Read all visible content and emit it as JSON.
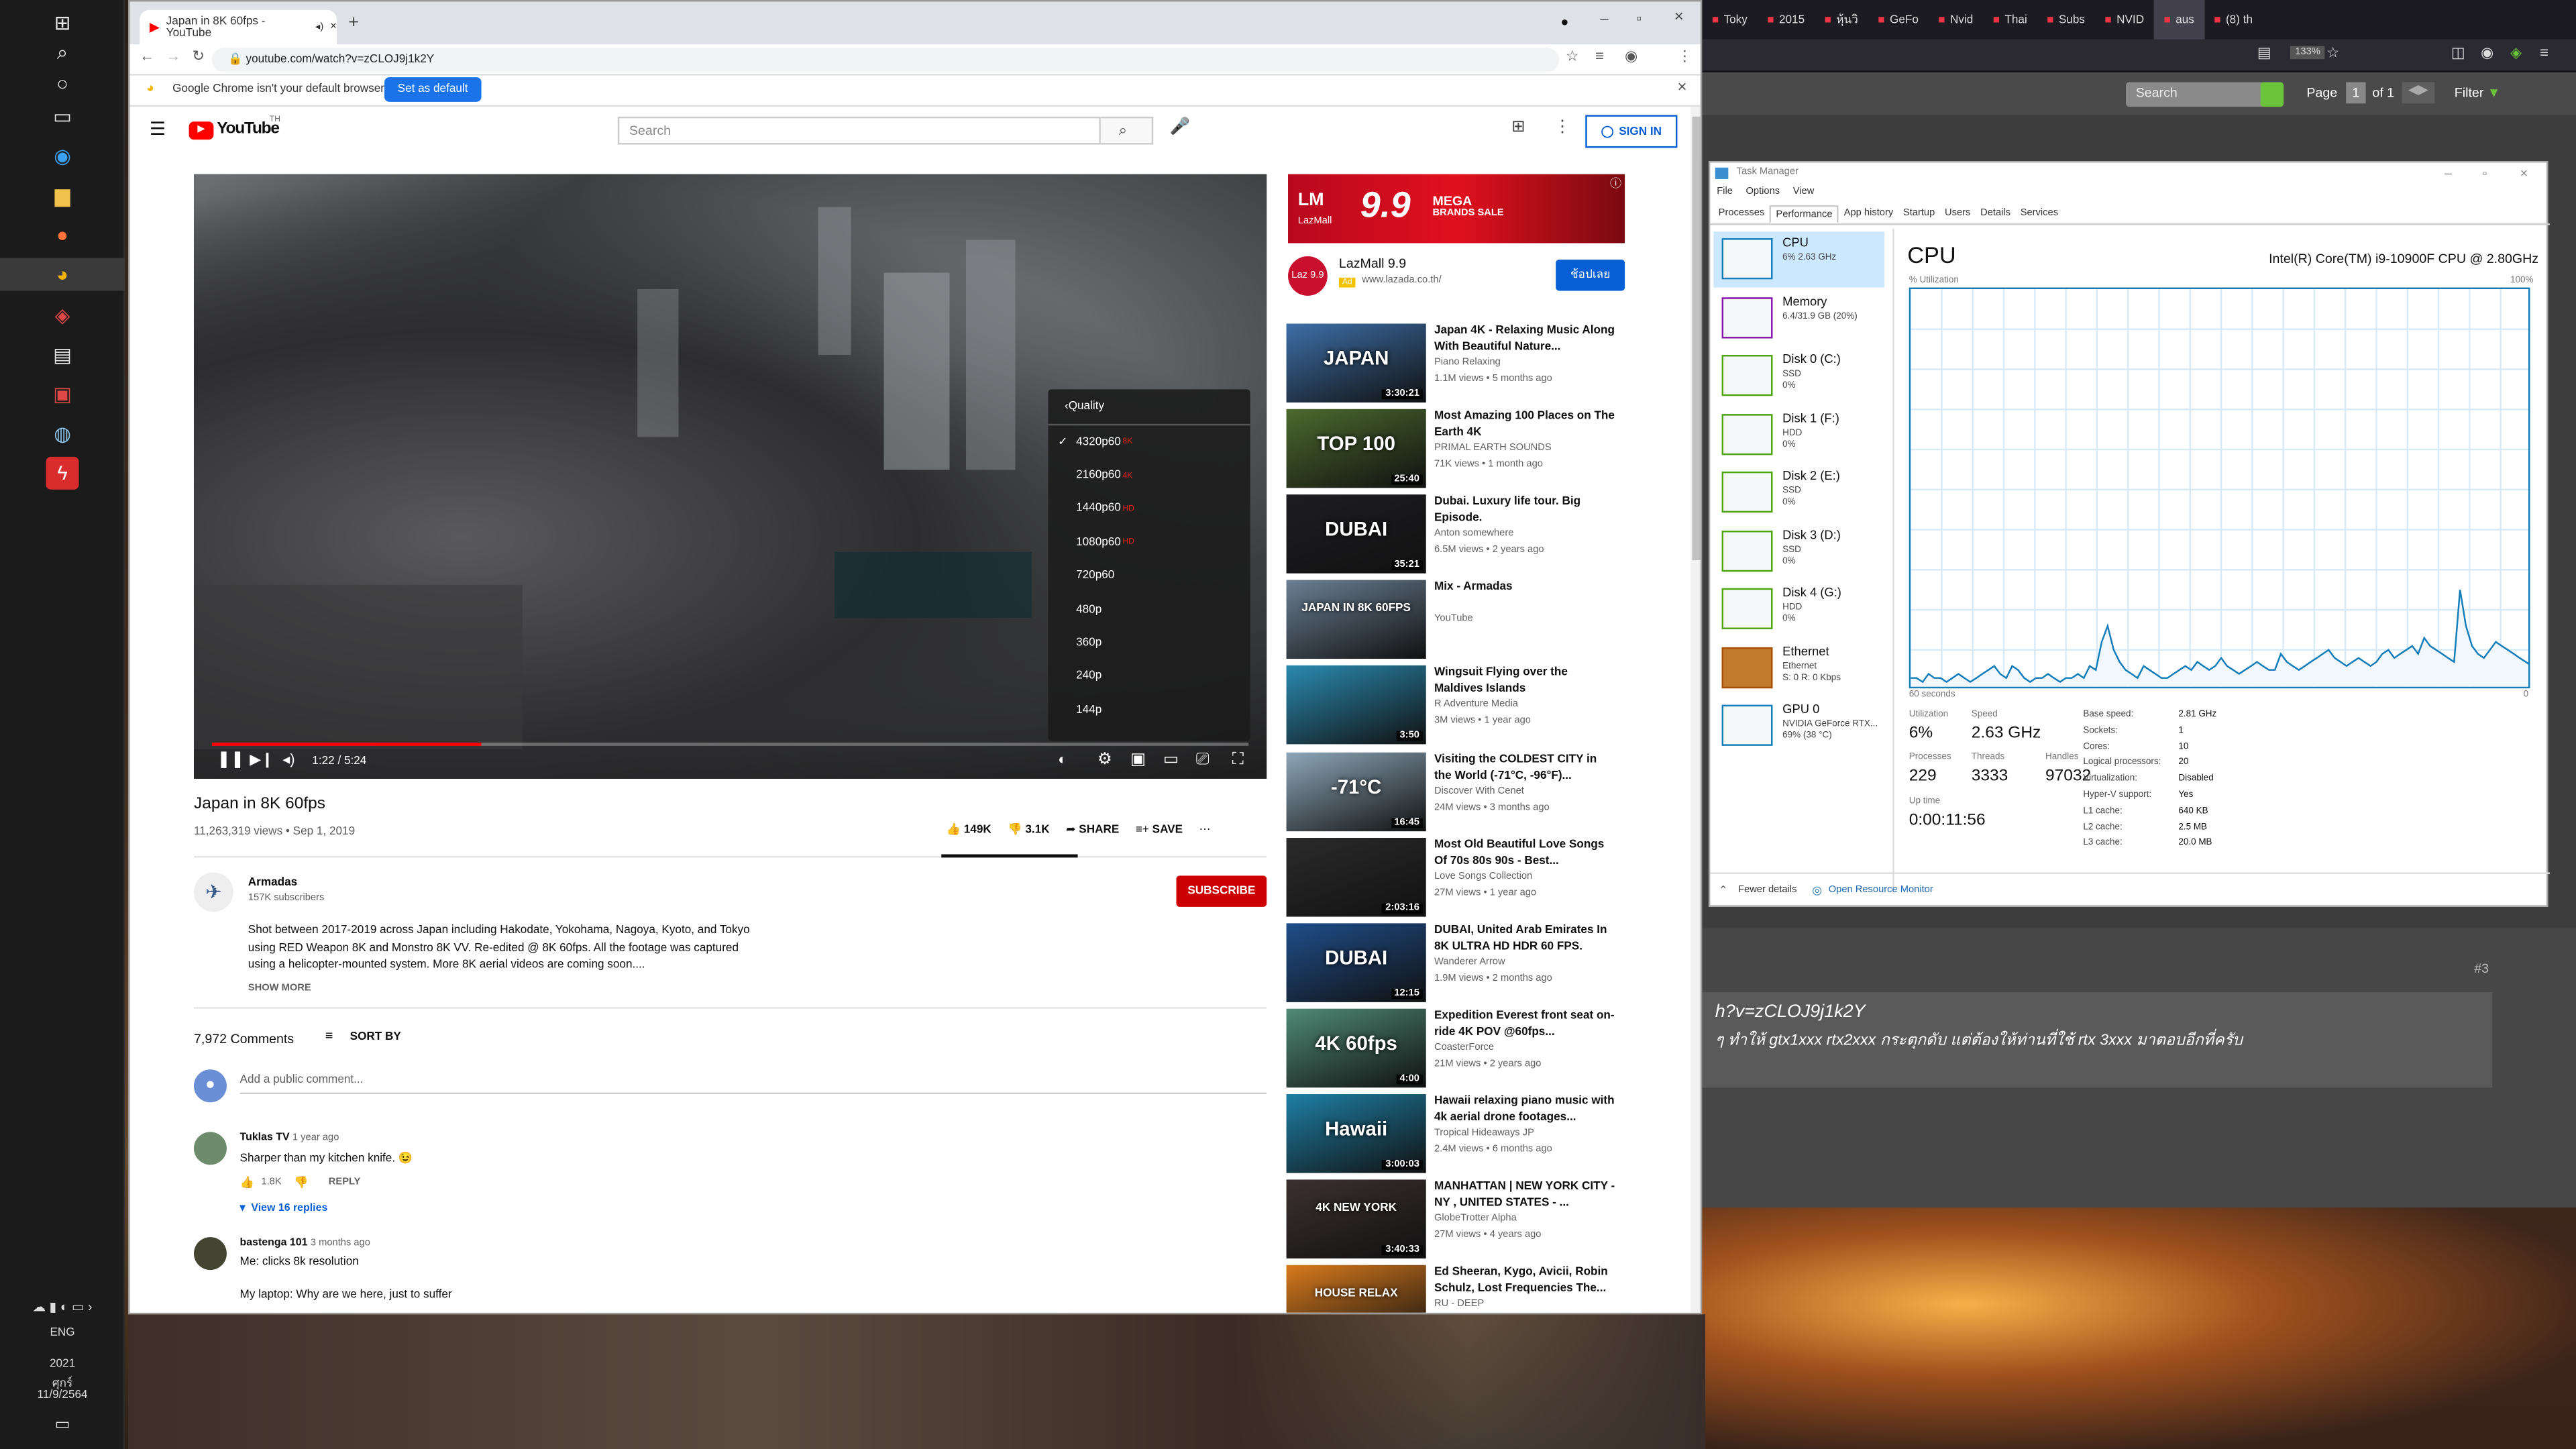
{
  "taskbar": {
    "lang": "ENG",
    "time": "2021",
    "day": "ศุกร์",
    "date": "11/9/2564"
  },
  "firefox": {
    "tabs": [
      "Toky",
      "2015",
      "หุ้นวิ",
      "GeFo",
      "Nvid",
      "Thai",
      "Subs",
      "NVID",
      "aus",
      "(8) th"
    ],
    "zoom": "133%",
    "search_placeholder": "Search",
    "page_label": "Page",
    "page_num": "1",
    "page_of": "of 1",
    "filter": "Filter",
    "post_num": "#3",
    "quote_line1": "h?v=zCLOJ9j1k2Y",
    "quote_line2": "ๆ ทำให้ gtx1xxx rtx2xxx กระตุกดับ แต่ต้องให้ท่านที่ใช้ rtx 3xxx มาตอบอีกที่ครับ"
  },
  "chrome": {
    "tab_title": "Japan in 8K 60fps - YouTube",
    "url": "youtube.com/watch?v=zCLOJ9j1k2Y",
    "default_msg": "Google Chrome isn't your default browser",
    "set_default": "Set as default"
  },
  "youtube": {
    "logo": "YouTube",
    "logo_sup": "TH",
    "search_placeholder": "Search",
    "sign_in": "SIGN IN",
    "quality_menu": {
      "header": "Quality",
      "options": [
        "4320p60",
        "2160p60",
        "1440p60",
        "1080p60",
        "720p60",
        "480p",
        "360p",
        "240p",
        "144p"
      ],
      "hd": [
        "8K",
        "4K",
        "HD",
        "HD",
        "",
        "",
        "",
        "",
        ""
      ],
      "selected": "4320p60"
    },
    "time": "1:22 / 5:24",
    "progress": 0.26,
    "title": "Japan in 8K 60fps",
    "meta": "11,263,319 views • Sep 1, 2019",
    "likes": "149K",
    "dislikes": "3.1K",
    "share": "SHARE",
    "save": "SAVE",
    "channel": "Armadas",
    "subscribers": "157K subscribers",
    "subscribe": "SUBSCRIBE",
    "description": "Shot between 2017-2019 across Japan including Hakodate, Yokohama, Nagoya, Kyoto, and Tokyo  using RED Weapon 8K and Monstro 8K VV. Re-edited @ 8K 60fps. All the footage was captured using a helicopter-mounted system. More 8K aerial videos are coming soon....",
    "show_more": "SHOW MORE",
    "comments_count": "7,972 Comments",
    "sort_by": "SORT BY",
    "add_comment": "Add a public comment...",
    "comments": [
      {
        "author": "Tuklas TV",
        "age": "1 year ago",
        "text": "Sharper than my kitchen knife. 😉",
        "likes": "1.8K",
        "reply": "REPLY",
        "view_replies": "View 16 replies"
      },
      {
        "author": "bastenga 101",
        "age": "3 months ago",
        "text": "Me: clicks 8k resolution",
        "text2": "My laptop: Why are we here, just to suffer"
      }
    ],
    "ad": {
      "brand": "LazMall",
      "big": "9.9",
      "sub1": "MEGA",
      "sub2": "BRANDS SALE",
      "name": "LazMall 9.9",
      "ad_tag": "Ad",
      "site": "www.lazada.co.th/",
      "cta": "ช้อปเลย",
      "logo": "Laz 9.9"
    },
    "recs": [
      {
        "title": "Japan 4K - Relaxing Music Along With Beautiful Nature...",
        "channel": "Piano Relaxing",
        "views": "1.1M views • 5 months ago",
        "dur": "3:30:21",
        "thumb": "JAPAN",
        "color": "#3d6fa8"
      },
      {
        "title": "Most Amazing 100 Places on The Earth 4K",
        "channel": "PRIMAL EARTH SOUNDS",
        "views": "71K views • 1 month ago",
        "dur": "25:40",
        "thumb": "TOP 100",
        "color": "#4c6a2e"
      },
      {
        "title": "Dubai. Luxury life tour. Big Episode.",
        "channel": "Anton somewhere",
        "views": "6.5M views • 2 years ago",
        "dur": "35:21",
        "thumb": "DUBAI",
        "color": "#1e1e22"
      },
      {
        "title": "Mix - Armadas",
        "channel": "YouTube",
        "views": "",
        "dur": "",
        "thumb": "JAPAN IN 8K 60FPS",
        "color": "#6a7f93"
      },
      {
        "title": "Wingsuit Flying over the Maldives Islands",
        "channel": "R Adventure Media",
        "views": "3M views • 1 year ago",
        "dur": "3:50",
        "thumb": "",
        "color": "#2a8ab0"
      },
      {
        "title": "Visiting the COLDEST CITY in the World (-71°C, -96°F)...",
        "channel": "Discover With Cenet",
        "views": "24M views • 3 months ago",
        "dur": "16:45",
        "thumb": "-71°C",
        "color": "#8ea7b9"
      },
      {
        "title": "Most Old Beautiful Love Songs Of 70s 80s 90s - Best...",
        "channel": "Love Songs Collection",
        "views": "27M views • 1 year ago",
        "dur": "2:03:16",
        "thumb": "",
        "color": "#2b2b2b"
      },
      {
        "title": "DUBAI, United Arab Emirates In 8K ULTRA HD HDR 60 FPS.",
        "channel": "Wanderer Arrow",
        "views": "1.9M views • 2 months ago",
        "dur": "12:15",
        "thumb": "DUBAI",
        "color": "#1f4e8a"
      },
      {
        "title": "Expedition Everest front seat on-ride 4K POV @60fps...",
        "channel": "CoasterForce",
        "views": "21M views • 2 years ago",
        "dur": "4:00",
        "thumb": "4K 60fps",
        "color": "#4f8a76"
      },
      {
        "title": "Hawaii relaxing piano music with 4k aerial drone footages...",
        "channel": "Tropical Hideaways JP",
        "views": "2.4M views • 6 months ago",
        "dur": "3:00:03",
        "thumb": "Hawaii",
        "color": "#1e7fa5"
      },
      {
        "title": "MANHATTAN | NEW YORK CITY - NY , UNITED STATES - ...",
        "channel": "GlobeTrotter Alpha",
        "views": "27M views • 4 years ago",
        "dur": "3:40:33",
        "thumb": "4K NEW YORK",
        "color": "#3c3030"
      },
      {
        "title": "Ed Sheeran, Kygo, Avicii, Robin Schulz, Lost Frequencies The...",
        "channel": "RU - DEEP",
        "views": "",
        "dur": "",
        "thumb": "HOUSE RELAX",
        "color": "#d97a1c"
      }
    ]
  },
  "taskmgr": {
    "title": "Task Manager",
    "menu": [
      "File",
      "Options",
      "View"
    ],
    "tabs": [
      "Processes",
      "Performance",
      "App history",
      "Startup",
      "Users",
      "Details",
      "Services"
    ],
    "items": [
      {
        "name": "CPU",
        "s1": "6% 2.63 GHz",
        "s2": ""
      },
      {
        "name": "Memory",
        "s1": "6.4/31.9 GB (20%)",
        "s2": ""
      },
      {
        "name": "Disk 0 (C:)",
        "s1": "SSD",
        "s2": "0%"
      },
      {
        "name": "Disk 1 (F:)",
        "s1": "HDD",
        "s2": "0%"
      },
      {
        "name": "Disk 2 (E:)",
        "s1": "SSD",
        "s2": "0%"
      },
      {
        "name": "Disk 3 (D:)",
        "s1": "SSD",
        "s2": "0%"
      },
      {
        "name": "Disk 4 (G:)",
        "s1": "HDD",
        "s2": "0%"
      },
      {
        "name": "Ethernet",
        "s1": "Ethernet",
        "s2": "S: 0 R: 0 Kbps"
      },
      {
        "name": "GPU 0",
        "s1": "NVIDIA GeForce RTX...",
        "s2": "69% (38 °C)"
      }
    ],
    "cpu_title": "CPU",
    "cpu_model": "Intel(R) Core(TM) i9-10900F CPU @ 2.80GHz",
    "util_label": "% Utilization",
    "max_label": "100%",
    "secs_label": "60 seconds",
    "zero_label": "0",
    "utilization_label": "Utilization",
    "utilization": "6%",
    "speed_label": "Speed",
    "speed": "2.63 GHz",
    "processes_label": "Processes",
    "processes": "229",
    "threads_label": "Threads",
    "threads": "3333",
    "handles_label": "Handles",
    "handles": "97032",
    "uptime_label": "Up time",
    "uptime": "0:00:11:56",
    "specs": [
      [
        "Base speed:",
        "2.81 GHz"
      ],
      [
        "Sockets:",
        "1"
      ],
      [
        "Cores:",
        "10"
      ],
      [
        "Logical processors:",
        "20"
      ],
      [
        "Virtualization:",
        "Disabled"
      ],
      [
        "Hyper-V support:",
        "Yes"
      ],
      [
        "L1 cache:",
        "640 KB"
      ],
      [
        "L2 cache:",
        "2.5 MB"
      ],
      [
        "L3 cache:",
        "20.0 MB"
      ]
    ],
    "fewer": "Fewer details",
    "open_rm": "Open Resource Monitor",
    "cpu_history": [
      3,
      3,
      2,
      4,
      3,
      3,
      2,
      3,
      4,
      3,
      2,
      3,
      4,
      5,
      6,
      4,
      3,
      6,
      5,
      3,
      2,
      3,
      3,
      4,
      3,
      2,
      3,
      3,
      4,
      3,
      6,
      5,
      12,
      16,
      10,
      7,
      5,
      4,
      3,
      6,
      5,
      4,
      3,
      3,
      4,
      5,
      6,
      5,
      7,
      6,
      5,
      6,
      8,
      6,
      5,
      4,
      5,
      6,
      7,
      6,
      5,
      5,
      9,
      7,
      6,
      5,
      6,
      7,
      8,
      9,
      10,
      8,
      7,
      6,
      7,
      8,
      7,
      6,
      7,
      9,
      10,
      8,
      9,
      10,
      11,
      9,
      13,
      11,
      10,
      9,
      8,
      7,
      25,
      16,
      11,
      9,
      8,
      10,
      12,
      11,
      10,
      9,
      8,
      7,
      6
    ]
  }
}
